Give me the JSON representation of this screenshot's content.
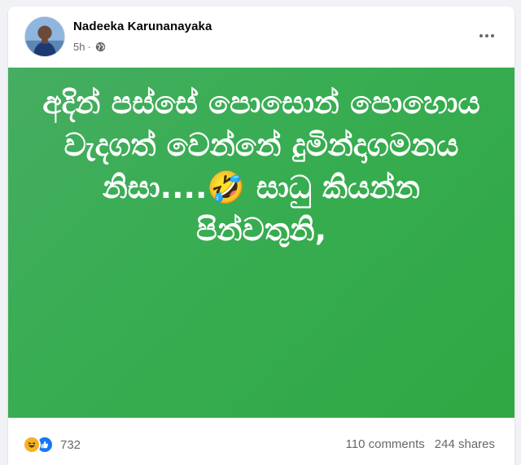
{
  "post": {
    "author": "Nadeeka Karunanayaka",
    "time": "5h",
    "separator": "·",
    "privacy_icon": "globe-icon",
    "text": "අදින් පස්සේ පොසොන් පොහොය වැදගත් වෙන්නේ දුමින්දාගමනය නිසා....🤣 සාධු කියන්න පින්වතුනි,",
    "background_color": "#3aab52"
  },
  "footer": {
    "reaction_icons": [
      "haha-icon",
      "like-icon"
    ],
    "reaction_count": "732",
    "comments": "110 comments",
    "shares": "244 shares"
  },
  "colors": {
    "text_secondary": "#65676b",
    "like_blue": "#1877f2",
    "haha_yellow": "#f7b125"
  }
}
